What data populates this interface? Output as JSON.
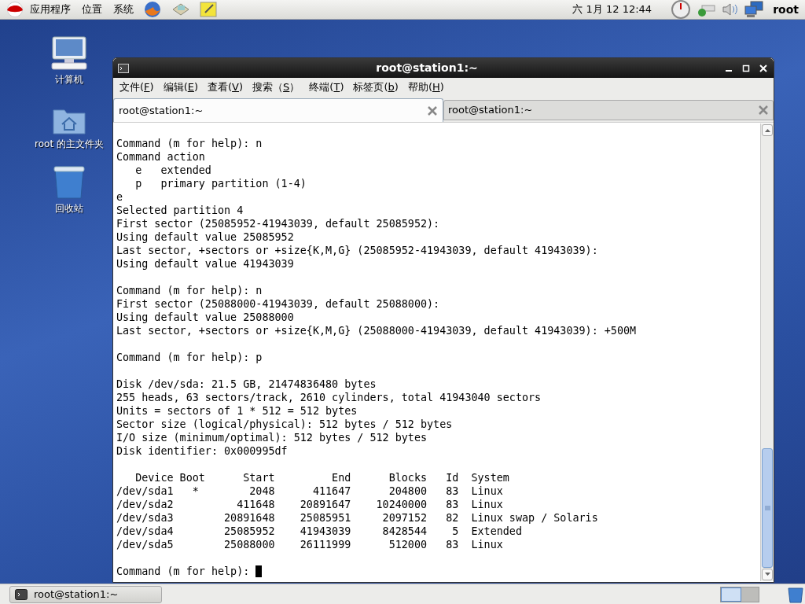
{
  "top_panel": {
    "menus": [
      "应用程序",
      "位置",
      "系统"
    ],
    "clock": "六 1月 12 12:44",
    "user": "root"
  },
  "desktop_icons": [
    {
      "kind": "computer",
      "label": "计算机"
    },
    {
      "kind": "home",
      "label": "root 的主文件夹"
    },
    {
      "kind": "trash",
      "label": "回收站"
    }
  ],
  "window": {
    "title": "root@station1:~",
    "menu": [
      {
        "label": "文件(",
        "key": "F",
        "end": ")"
      },
      {
        "label": "编辑(",
        "key": "E",
        "end": ")"
      },
      {
        "label": "查看(",
        "key": "V",
        "end": ")"
      },
      {
        "label": "搜索（",
        "key": "S",
        "end": "）"
      },
      {
        "label": "终端(",
        "key": "T",
        "end": ")"
      },
      {
        "label": "标签页(",
        "key": "b",
        "end": ")"
      },
      {
        "label": "帮助(",
        "key": "H",
        "end": ")"
      }
    ],
    "tabs": [
      {
        "label": "root@station1:~",
        "selected": true
      },
      {
        "label": "root@station1:~",
        "selected": false
      }
    ],
    "terminal_blocks": [
      [
        "Command (m for help): n",
        "Command action",
        "   e   extended",
        "   p   primary partition (1-4)",
        "e",
        "Selected partition 4",
        "First sector (25085952-41943039, default 25085952):",
        "Using default value 25085952",
        "Last sector, +sectors or +size{K,M,G} (25085952-41943039, default 41943039):",
        "Using default value 41943039"
      ],
      [
        "Command (m for help): n",
        "First sector (25088000-41943039, default 25088000):",
        "Using default value 25088000",
        "Last sector, +sectors or +size{K,M,G} (25088000-41943039, default 41943039): +500M"
      ],
      [
        "Command (m for help): p"
      ],
      [
        "Disk /dev/sda: 21.5 GB, 21474836480 bytes",
        "255 heads, 63 sectors/track, 2610 cylinders, total 41943040 sectors",
        "Units = sectors of 1 * 512 = 512 bytes",
        "Sector size (logical/physical): 512 bytes / 512 bytes",
        "I/O size (minimum/optimal): 512 bytes / 512 bytes",
        "Disk identifier: 0x000995df"
      ],
      [
        "   Device Boot      Start         End      Blocks   Id  System",
        "/dev/sda1   *        2048      411647      204800   83  Linux",
        "/dev/sda2          411648    20891647    10240000   83  Linux",
        "/dev/sda3        20891648    25085951     2097152   82  Linux swap / Solaris",
        "/dev/sda4        25085952    41943039     8428544    5  Extended",
        "/dev/sda5        25088000    26111999      512000   83  Linux"
      ]
    ],
    "prompt": "Command (m for help): "
  },
  "taskbar": {
    "items": [
      {
        "label": "root@station1:~",
        "selected": false
      }
    ]
  }
}
